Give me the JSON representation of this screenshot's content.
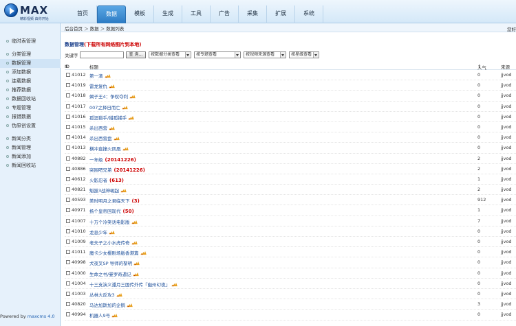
{
  "logo": {
    "text": "MAX",
    "slogan": "精彩视频 由你开始"
  },
  "nav": [
    "首页",
    "数据",
    "模板",
    "生成",
    "工具",
    "广告",
    "采集",
    "扩展",
    "系统"
  ],
  "sidebar": {
    "top": [
      "临时表管理"
    ],
    "data": [
      "分类管理",
      "数据管理",
      "添加数据",
      "连载数据",
      "推荐数据",
      "数据回收站",
      "专题管理",
      "报错数据",
      "伪原创设置"
    ],
    "news": [
      "新闻分类",
      "新闻管理",
      "新闻添加",
      "新闻回收站"
    ],
    "powered_prefix": "Powered by ",
    "powered_link": "maxcms 4.0"
  },
  "breadcrumb": "后台首页 ＞ 数据 ＞ 数据列表",
  "welcome": "您好",
  "page_title": "数据管理",
  "page_title_note": "(下载所有网络图片到本地)",
  "filters": {
    "keyword_label": "关键字",
    "keyword_value": "",
    "query": "查 询...",
    "selects": [
      "按数据分类查看",
      "按专题查看",
      "按视频来源查看",
      "按星级查看"
    ]
  },
  "columns": {
    "id": "ID",
    "sort_icon": "⇕",
    "title": "标题",
    "popularity": "人气",
    "source": "来源"
  },
  "rows": [
    {
      "id": "41012",
      "title": "第一滴",
      "tag": "",
      "hot": true,
      "pop": "0",
      "src": "jjvod"
    },
    {
      "id": "41019",
      "title": "雷龙复仇",
      "tag": "",
      "hot": true,
      "pop": "0",
      "src": "jjvod"
    },
    {
      "id": "41018",
      "title": "蝎子王4：争权夺利",
      "tag": "",
      "hot": true,
      "pop": "0",
      "src": "jjvod"
    },
    {
      "id": "41017",
      "title": "007之择日而亡",
      "tag": "",
      "hot": true,
      "pop": "0",
      "src": "jjvod"
    },
    {
      "id": "41016",
      "title": "孤涯猎手/猎孤捕手",
      "tag": "",
      "hot": true,
      "pop": "0",
      "src": "jjvod"
    },
    {
      "id": "41015",
      "title": "杀出西营",
      "tag": "",
      "hot": true,
      "pop": "0",
      "src": "jjvod"
    },
    {
      "id": "41014",
      "title": "杀出西营盘",
      "tag": "",
      "hot": true,
      "pop": "0",
      "src": "jjvod"
    },
    {
      "id": "41013",
      "title": "横冲直撞火凤凰",
      "tag": "",
      "hot": true,
      "pop": "0",
      "src": "jjvod"
    },
    {
      "id": "40882",
      "title": "一年级",
      "tag": "(20141226)",
      "hot": false,
      "pop": "2",
      "src": "jjvod"
    },
    {
      "id": "40886",
      "title": "突围吧兄弟",
      "tag": "(20141226)",
      "hot": false,
      "pop": "2",
      "src": "jjvod"
    },
    {
      "id": "40612",
      "title": "火影忍者",
      "tag": "(613)",
      "hot": false,
      "pop": "1",
      "src": "jjvod"
    },
    {
      "id": "40821",
      "title": "魁拔3战神崛起",
      "tag": "",
      "hot": true,
      "pop": "2",
      "src": "jjvod"
    },
    {
      "id": "40593",
      "title": "美时明月之君临天下",
      "tag": "(3)",
      "hot": false,
      "pop": "912",
      "src": "jjvod"
    },
    {
      "id": "40971",
      "title": "扬个皇帝回现代",
      "tag": "(50)",
      "hot": false,
      "pop": "1",
      "src": "jjvod"
    },
    {
      "id": "41007",
      "title": "十万个冷笑话电影版",
      "tag": "",
      "hot": true,
      "pop": "7",
      "src": "jjvod"
    },
    {
      "id": "41010",
      "title": "龙息少年",
      "tag": "",
      "hot": true,
      "pop": "0",
      "src": "jjvod"
    },
    {
      "id": "41009",
      "title": "老夫子之小水虎传奇",
      "tag": "",
      "hot": true,
      "pop": "0",
      "src": "jjvod"
    },
    {
      "id": "41011",
      "title": "魔卡少女樱剧场版香港篇",
      "tag": "",
      "hot": true,
      "pop": "0",
      "src": "jjvod"
    },
    {
      "id": "40998",
      "title": "犬夜叉SP 导师的黎明",
      "tag": "",
      "hot": true,
      "pop": "0",
      "src": "jjvod"
    },
    {
      "id": "41000",
      "title": "生命之书/曼罗奇遇记",
      "tag": "",
      "hot": true,
      "pop": "0",
      "src": "jjvod"
    },
    {
      "id": "41004",
      "title": "十三支演义潘月三国传外传『幽州幻夜』",
      "tag": "",
      "hot": true,
      "pop": "0",
      "src": "jjvod"
    },
    {
      "id": "41003",
      "title": "丛林大反攻3",
      "tag": "",
      "hot": true,
      "pop": "0",
      "src": "jjvod"
    },
    {
      "id": "40820",
      "title": "马达加斯加的企鹅",
      "tag": "",
      "hot": true,
      "pop": "3",
      "src": "jjvod"
    },
    {
      "id": "40994",
      "title": "机器人9号",
      "tag": "",
      "hot": true,
      "pop": "0",
      "src": "jjvod"
    }
  ]
}
